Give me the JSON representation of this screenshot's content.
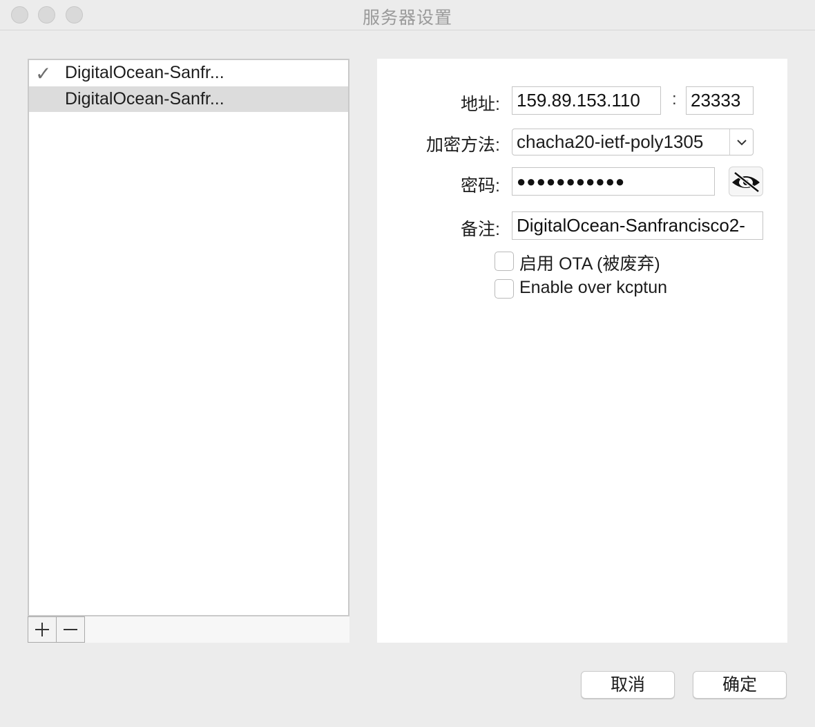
{
  "window": {
    "title": "服务器设置"
  },
  "server_list": {
    "items": [
      {
        "name": "DigitalOcean-Sanfr...",
        "checked": true,
        "check_mark": "✓"
      },
      {
        "name": "DigitalOcean-Sanfr...",
        "checked": false,
        "selected": true
      }
    ],
    "add_label": "+",
    "remove_label": "−"
  },
  "form": {
    "address_label": "地址:",
    "address_value": "159.89.153.110",
    "port_separator": ":",
    "port_value": "23333",
    "method_label": "加密方法:",
    "method_value": "chacha20-ietf-poly1305",
    "password_label": "密码:",
    "password_value": "●●●●●●●●●●●",
    "remark_label": "备注:",
    "remark_value": "DigitalOcean-Sanfrancisco2-",
    "ota_label": "启用 OTA (被废弃)",
    "ota_checked": false,
    "kcptun_label": "Enable over kcptun",
    "kcptun_checked": false
  },
  "buttons": {
    "cancel": "取消",
    "ok": "确定"
  },
  "icons": {
    "check": "checkmark-icon",
    "reveal": "eye-slash-icon",
    "dropdown": "chevron-down-icon"
  }
}
